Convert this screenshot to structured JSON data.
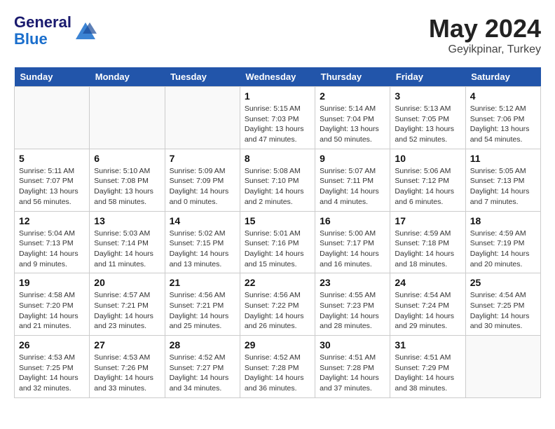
{
  "header": {
    "logo_line1": "General",
    "logo_line2": "Blue",
    "month": "May 2024",
    "location": "Geyikpinar, Turkey"
  },
  "weekdays": [
    "Sunday",
    "Monday",
    "Tuesday",
    "Wednesday",
    "Thursday",
    "Friday",
    "Saturday"
  ],
  "weeks": [
    [
      {
        "day": "",
        "info": ""
      },
      {
        "day": "",
        "info": ""
      },
      {
        "day": "",
        "info": ""
      },
      {
        "day": "1",
        "info": "Sunrise: 5:15 AM\nSunset: 7:03 PM\nDaylight: 13 hours\nand 47 minutes."
      },
      {
        "day": "2",
        "info": "Sunrise: 5:14 AM\nSunset: 7:04 PM\nDaylight: 13 hours\nand 50 minutes."
      },
      {
        "day": "3",
        "info": "Sunrise: 5:13 AM\nSunset: 7:05 PM\nDaylight: 13 hours\nand 52 minutes."
      },
      {
        "day": "4",
        "info": "Sunrise: 5:12 AM\nSunset: 7:06 PM\nDaylight: 13 hours\nand 54 minutes."
      }
    ],
    [
      {
        "day": "5",
        "info": "Sunrise: 5:11 AM\nSunset: 7:07 PM\nDaylight: 13 hours\nand 56 minutes."
      },
      {
        "day": "6",
        "info": "Sunrise: 5:10 AM\nSunset: 7:08 PM\nDaylight: 13 hours\nand 58 minutes."
      },
      {
        "day": "7",
        "info": "Sunrise: 5:09 AM\nSunset: 7:09 PM\nDaylight: 14 hours\nand 0 minutes."
      },
      {
        "day": "8",
        "info": "Sunrise: 5:08 AM\nSunset: 7:10 PM\nDaylight: 14 hours\nand 2 minutes."
      },
      {
        "day": "9",
        "info": "Sunrise: 5:07 AM\nSunset: 7:11 PM\nDaylight: 14 hours\nand 4 minutes."
      },
      {
        "day": "10",
        "info": "Sunrise: 5:06 AM\nSunset: 7:12 PM\nDaylight: 14 hours\nand 6 minutes."
      },
      {
        "day": "11",
        "info": "Sunrise: 5:05 AM\nSunset: 7:13 PM\nDaylight: 14 hours\nand 7 minutes."
      }
    ],
    [
      {
        "day": "12",
        "info": "Sunrise: 5:04 AM\nSunset: 7:13 PM\nDaylight: 14 hours\nand 9 minutes."
      },
      {
        "day": "13",
        "info": "Sunrise: 5:03 AM\nSunset: 7:14 PM\nDaylight: 14 hours\nand 11 minutes."
      },
      {
        "day": "14",
        "info": "Sunrise: 5:02 AM\nSunset: 7:15 PM\nDaylight: 14 hours\nand 13 minutes."
      },
      {
        "day": "15",
        "info": "Sunrise: 5:01 AM\nSunset: 7:16 PM\nDaylight: 14 hours\nand 15 minutes."
      },
      {
        "day": "16",
        "info": "Sunrise: 5:00 AM\nSunset: 7:17 PM\nDaylight: 14 hours\nand 16 minutes."
      },
      {
        "day": "17",
        "info": "Sunrise: 4:59 AM\nSunset: 7:18 PM\nDaylight: 14 hours\nand 18 minutes."
      },
      {
        "day": "18",
        "info": "Sunrise: 4:59 AM\nSunset: 7:19 PM\nDaylight: 14 hours\nand 20 minutes."
      }
    ],
    [
      {
        "day": "19",
        "info": "Sunrise: 4:58 AM\nSunset: 7:20 PM\nDaylight: 14 hours\nand 21 minutes."
      },
      {
        "day": "20",
        "info": "Sunrise: 4:57 AM\nSunset: 7:21 PM\nDaylight: 14 hours\nand 23 minutes."
      },
      {
        "day": "21",
        "info": "Sunrise: 4:56 AM\nSunset: 7:21 PM\nDaylight: 14 hours\nand 25 minutes."
      },
      {
        "day": "22",
        "info": "Sunrise: 4:56 AM\nSunset: 7:22 PM\nDaylight: 14 hours\nand 26 minutes."
      },
      {
        "day": "23",
        "info": "Sunrise: 4:55 AM\nSunset: 7:23 PM\nDaylight: 14 hours\nand 28 minutes."
      },
      {
        "day": "24",
        "info": "Sunrise: 4:54 AM\nSunset: 7:24 PM\nDaylight: 14 hours\nand 29 minutes."
      },
      {
        "day": "25",
        "info": "Sunrise: 4:54 AM\nSunset: 7:25 PM\nDaylight: 14 hours\nand 30 minutes."
      }
    ],
    [
      {
        "day": "26",
        "info": "Sunrise: 4:53 AM\nSunset: 7:25 PM\nDaylight: 14 hours\nand 32 minutes."
      },
      {
        "day": "27",
        "info": "Sunrise: 4:53 AM\nSunset: 7:26 PM\nDaylight: 14 hours\nand 33 minutes."
      },
      {
        "day": "28",
        "info": "Sunrise: 4:52 AM\nSunset: 7:27 PM\nDaylight: 14 hours\nand 34 minutes."
      },
      {
        "day": "29",
        "info": "Sunrise: 4:52 AM\nSunset: 7:28 PM\nDaylight: 14 hours\nand 36 minutes."
      },
      {
        "day": "30",
        "info": "Sunrise: 4:51 AM\nSunset: 7:28 PM\nDaylight: 14 hours\nand 37 minutes."
      },
      {
        "day": "31",
        "info": "Sunrise: 4:51 AM\nSunset: 7:29 PM\nDaylight: 14 hours\nand 38 minutes."
      },
      {
        "day": "",
        "info": ""
      }
    ]
  ]
}
